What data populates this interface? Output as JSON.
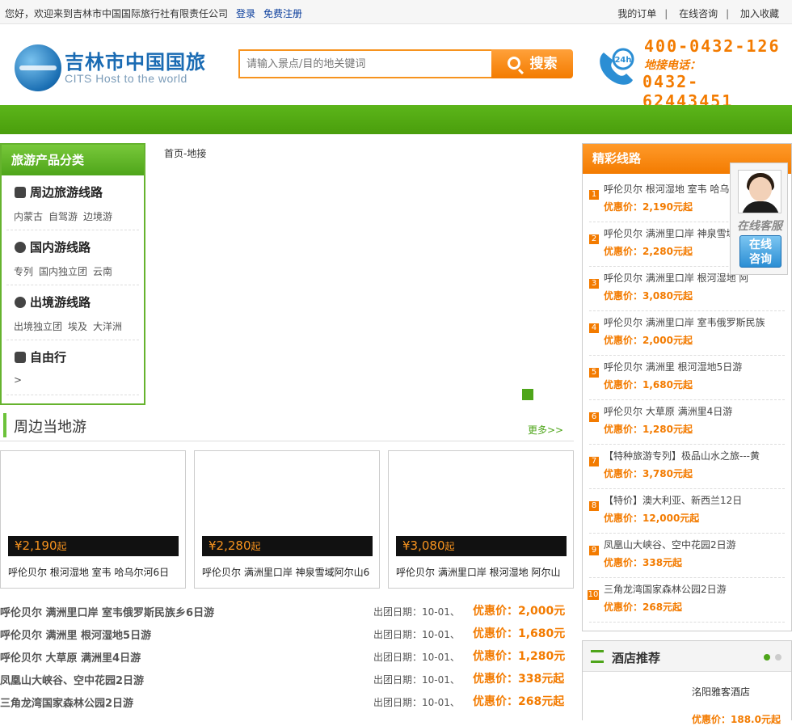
{
  "topbar": {
    "welcome": "您好，欢迎来到吉林市中国国际旅行社有限责任公司",
    "login": "登录",
    "register": "免费注册",
    "my_orders": "我的订单",
    "online_consult": "在线咨询",
    "favorite": "加入收藏",
    "separator": "|"
  },
  "logo": {
    "cn": "吉林市中国国旅",
    "en": "CITS Host to the world"
  },
  "search": {
    "placeholder": "请输入景点/目的地关键词",
    "button": "搜索"
  },
  "phone": {
    "hotline": "400-0432-126",
    "label": "地接电话：",
    "local": "0432-62443451",
    "badge": "24h"
  },
  "categories": {
    "title": "旅游产品分类",
    "items": [
      {
        "title": "周边旅游线路",
        "icon": "bus-icon",
        "subs": [
          "内蒙古",
          "自驾游",
          "边境游"
        ]
      },
      {
        "title": "国内游线路",
        "icon": "globe-icon",
        "subs": [
          "专列",
          "国内独立团",
          "云南"
        ]
      },
      {
        "title": "出境游线路",
        "icon": "world-icon",
        "subs": [
          "出境独立团",
          "埃及",
          "大洋洲"
        ]
      },
      {
        "title": "自由行",
        "icon": "suitcase-icon",
        "subs": [
          ">"
        ]
      }
    ]
  },
  "breadcrumb": {
    "home": "首页",
    "sep": "-",
    "current": "地接"
  },
  "local_tours": {
    "title": "周边当地游",
    "more": "更多>>",
    "cards": [
      {
        "price": "¥2,190",
        "unit": "起",
        "name": "呼伦贝尔 根河湿地 室韦 哈乌尔河6日"
      },
      {
        "price": "¥2,280",
        "unit": "起",
        "name": "呼伦贝尔 满洲里口岸 神泉雪域阿尔山6"
      },
      {
        "price": "¥3,080",
        "unit": "起",
        "name": "呼伦贝尔 满洲里口岸 根河湿地 阿尔山"
      }
    ],
    "list": [
      {
        "name": "呼伦贝尔 满洲里口岸 室韦俄罗斯民族乡6日游",
        "date": "出团日期：10-01、",
        "price": "优惠价：2,000元"
      },
      {
        "name": "呼伦贝尔 满洲里 根河湿地5日游",
        "date": "出团日期：10-01、",
        "price": "优惠价：1,680元"
      },
      {
        "name": "呼伦贝尔 大草原 满洲里4日游",
        "date": "出团日期：10-01、",
        "price": "优惠价：1,280元"
      },
      {
        "name": "凤凰山大峡谷、空中花园2日游",
        "date": "出团日期：10-01、",
        "price": "优惠价：338元起"
      },
      {
        "name": "三角龙湾国家森林公园2日游",
        "date": "出团日期：10-01、",
        "price": "优惠价：268元起"
      }
    ]
  },
  "featured": {
    "title": "精彩线路",
    "items": [
      {
        "num": "1",
        "title": "呼伦贝尔 根河湿地 室韦 哈乌尔",
        "price": "优惠价：2,190元起"
      },
      {
        "num": "2",
        "title": "呼伦贝尔 满洲里口岸 神泉雪域",
        "price": "优惠价：2,280元起"
      },
      {
        "num": "3",
        "title": "呼伦贝尔 满洲里口岸 根河湿地 阿",
        "price": "优惠价：3,080元起"
      },
      {
        "num": "4",
        "title": "呼伦贝尔 满洲里口岸 室韦俄罗斯民族",
        "price": "优惠价：2,000元起"
      },
      {
        "num": "5",
        "title": "呼伦贝尔 满洲里 根河湿地5日游",
        "price": "优惠价：1,680元起"
      },
      {
        "num": "6",
        "title": "呼伦贝尔 大草原 满洲里4日游",
        "price": "优惠价：1,280元起"
      },
      {
        "num": "7",
        "title": "【特种旅游专列】极品山水之旅---黄",
        "price": "优惠价：3,780元起"
      },
      {
        "num": "8",
        "title": "【特价】澳大利亚、新西兰12日",
        "price": "优惠价：12,000元起"
      },
      {
        "num": "9",
        "title": "凤凰山大峡谷、空中花园2日游",
        "price": "优惠价：338元起"
      },
      {
        "num": "10",
        "title": "三角龙湾国家森林公园2日游",
        "price": "优惠价：268元起"
      }
    ]
  },
  "kefu": {
    "label": "在线客服",
    "button_line1": "在线",
    "button_line2": "咨询"
  },
  "hotel": {
    "title": "酒店推荐",
    "name": "洺阳雅客酒店",
    "price": "优惠价：188.0元起"
  },
  "colors": {
    "green": "#4ea51a",
    "orange": "#f37b00",
    "blue": "#1a6bb3"
  }
}
